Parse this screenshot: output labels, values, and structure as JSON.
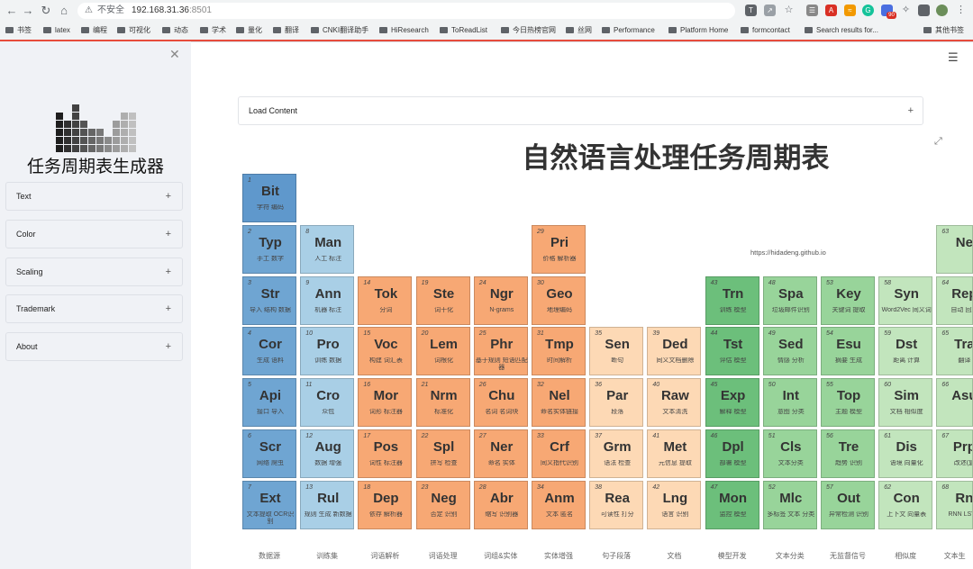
{
  "browser": {
    "nav_icons": [
      "back-icon",
      "forward-icon",
      "reload-icon",
      "home-icon"
    ],
    "insecure_label": "不安全",
    "url_host": "192.168.31.36",
    "url_port": ":8501",
    "bookmarks": [
      "书签",
      "latex",
      "编程",
      "可视化",
      "动态",
      "学术",
      "量化",
      "翻译",
      "CNKI翻译助手",
      "HiResearch",
      "ToReadList",
      "今日热榜官网",
      "丝网",
      "Performance",
      "Platform Home",
      "formcontact",
      "Search results for...",
      "其他书签"
    ],
    "badge_count": "90"
  },
  "sidebar": {
    "app_title": "任务周期表生成器",
    "sections": [
      "Text",
      "Color",
      "Scaling",
      "Trademark",
      "About"
    ]
  },
  "main": {
    "load_label": "Load Content",
    "page_title": "自然语言处理任务周期表",
    "credit": "https://hidadeng.github.io"
  },
  "palette": {
    "blue": "#6fa5d2",
    "blue_light": "#a9cfe6",
    "orange": "#f7a874",
    "peach": "#fdd9b5",
    "green_dark": "#6cbf7b",
    "green": "#98d49a",
    "green_light": "#c2e5bd"
  },
  "elements": [
    {
      "num": "1",
      "sym": "Bit",
      "cn": "字符 编码",
      "col": 0,
      "row": 0,
      "color": "blue_dark"
    },
    {
      "num": "2",
      "sym": "Typ",
      "cn": "手工 数字",
      "col": 0,
      "row": 1,
      "color": "blue"
    },
    {
      "num": "3",
      "sym": "Str",
      "cn": "导入 结构 数据",
      "col": 0,
      "row": 2,
      "color": "blue"
    },
    {
      "num": "4",
      "sym": "Cor",
      "cn": "生成 语料",
      "col": 0,
      "row": 3,
      "color": "blue"
    },
    {
      "num": "5",
      "sym": "Api",
      "cn": "接口 导入",
      "col": 0,
      "row": 4,
      "color": "blue"
    },
    {
      "num": "6",
      "sym": "Scr",
      "cn": "网络 爬虫",
      "col": 0,
      "row": 5,
      "color": "blue"
    },
    {
      "num": "7",
      "sym": "Ext",
      "cn": "文本提取 OCR识别",
      "col": 0,
      "row": 6,
      "color": "blue"
    },
    {
      "num": "8",
      "sym": "Man",
      "cn": "人工 标注",
      "col": 1,
      "row": 1,
      "color": "blue_light"
    },
    {
      "num": "9",
      "sym": "Ann",
      "cn": "机器 标注",
      "col": 1,
      "row": 2,
      "color": "blue_light"
    },
    {
      "num": "10",
      "sym": "Pro",
      "cn": "训练 数据",
      "col": 1,
      "row": 3,
      "color": "blue_light"
    },
    {
      "num": "11",
      "sym": "Cro",
      "cn": "众包",
      "col": 1,
      "row": 4,
      "color": "blue_light"
    },
    {
      "num": "12",
      "sym": "Aug",
      "cn": "数据 增强",
      "col": 1,
      "row": 5,
      "color": "blue_light"
    },
    {
      "num": "13",
      "sym": "Rul",
      "cn": "规则 生成 新数据",
      "col": 1,
      "row": 6,
      "color": "blue_light"
    },
    {
      "num": "14",
      "sym": "Tok",
      "cn": "分词",
      "col": 2,
      "row": 2,
      "color": "orange"
    },
    {
      "num": "15",
      "sym": "Voc",
      "cn": "构建 词汇表",
      "col": 2,
      "row": 3,
      "color": "orange"
    },
    {
      "num": "16",
      "sym": "Mor",
      "cn": "词形 标注器",
      "col": 2,
      "row": 4,
      "color": "orange"
    },
    {
      "num": "17",
      "sym": "Pos",
      "cn": "词性 标注器",
      "col": 2,
      "row": 5,
      "color": "orange"
    },
    {
      "num": "18",
      "sym": "Dep",
      "cn": "依存 解析器",
      "col": 2,
      "row": 6,
      "color": "orange"
    },
    {
      "num": "19",
      "sym": "Ste",
      "cn": "词干化",
      "col": 3,
      "row": 2,
      "color": "orange"
    },
    {
      "num": "20",
      "sym": "Lem",
      "cn": "词根化",
      "col": 3,
      "row": 3,
      "color": "orange"
    },
    {
      "num": "21",
      "sym": "Nrm",
      "cn": "标准化",
      "col": 3,
      "row": 4,
      "color": "orange"
    },
    {
      "num": "22",
      "sym": "Spl",
      "cn": "拼写 检查",
      "col": 3,
      "row": 5,
      "color": "orange"
    },
    {
      "num": "23",
      "sym": "Neg",
      "cn": "否定 识别",
      "col": 3,
      "row": 6,
      "color": "orange"
    },
    {
      "num": "24",
      "sym": "Ngr",
      "cn": "N-grams",
      "col": 4,
      "row": 2,
      "color": "orange"
    },
    {
      "num": "25",
      "sym": "Phr",
      "cn": "基于规则 短语匹配器",
      "col": 4,
      "row": 3,
      "color": "orange"
    },
    {
      "num": "26",
      "sym": "Chu",
      "cn": "名词 名词块",
      "col": 4,
      "row": 4,
      "color": "orange"
    },
    {
      "num": "27",
      "sym": "Ner",
      "cn": "命名 实体",
      "col": 4,
      "row": 5,
      "color": "orange"
    },
    {
      "num": "28",
      "sym": "Abr",
      "cn": "缩写 识别器",
      "col": 4,
      "row": 6,
      "color": "orange"
    },
    {
      "num": "29",
      "sym": "Pri",
      "cn": "价格 解析器",
      "col": 5,
      "row": 1,
      "color": "orange"
    },
    {
      "num": "30",
      "sym": "Geo",
      "cn": "地理编码",
      "col": 5,
      "row": 2,
      "color": "orange"
    },
    {
      "num": "31",
      "sym": "Tmp",
      "cn": "时间解析",
      "col": 5,
      "row": 3,
      "color": "orange"
    },
    {
      "num": "32",
      "sym": "Nel",
      "cn": "命名实体链接",
      "col": 5,
      "row": 4,
      "color": "orange"
    },
    {
      "num": "33",
      "sym": "Crf",
      "cn": "同义指代识别",
      "col": 5,
      "row": 5,
      "color": "orange"
    },
    {
      "num": "34",
      "sym": "Anm",
      "cn": "文本 匿名",
      "col": 5,
      "row": 6,
      "color": "orange"
    },
    {
      "num": "35",
      "sym": "Sen",
      "cn": "断句",
      "col": 6,
      "row": 3,
      "color": "peach"
    },
    {
      "num": "36",
      "sym": "Par",
      "cn": "段落",
      "col": 6,
      "row": 4,
      "color": "peach"
    },
    {
      "num": "37",
      "sym": "Grm",
      "cn": "语法 检查",
      "col": 6,
      "row": 5,
      "color": "peach"
    },
    {
      "num": "38",
      "sym": "Rea",
      "cn": "可读性 打分",
      "col": 6,
      "row": 6,
      "color": "peach"
    },
    {
      "num": "39",
      "sym": "Ded",
      "cn": "同义文档删除",
      "col": 7,
      "row": 3,
      "color": "peach"
    },
    {
      "num": "40",
      "sym": "Raw",
      "cn": "文本清洗",
      "col": 7,
      "row": 4,
      "color": "peach"
    },
    {
      "num": "41",
      "sym": "Met",
      "cn": "元信息 提取",
      "col": 7,
      "row": 5,
      "color": "peach"
    },
    {
      "num": "42",
      "sym": "Lng",
      "cn": "语言 识别",
      "col": 7,
      "row": 6,
      "color": "peach"
    },
    {
      "num": "43",
      "sym": "Trn",
      "cn": "训练 模型",
      "col": 8,
      "row": 2,
      "color": "green_dark"
    },
    {
      "num": "44",
      "sym": "Tst",
      "cn": "评估 模型",
      "col": 8,
      "row": 3,
      "color": "green_dark"
    },
    {
      "num": "45",
      "sym": "Exp",
      "cn": "解释 模型",
      "col": 8,
      "row": 4,
      "color": "green_dark"
    },
    {
      "num": "46",
      "sym": "Dpl",
      "cn": "部署 模型",
      "col": 8,
      "row": 5,
      "color": "green_dark"
    },
    {
      "num": "47",
      "sym": "Mon",
      "cn": "监控 模型",
      "col": 8,
      "row": 6,
      "color": "green_dark"
    },
    {
      "num": "48",
      "sym": "Spa",
      "cn": "垃圾邮件识别",
      "col": 9,
      "row": 2,
      "color": "green"
    },
    {
      "num": "49",
      "sym": "Sed",
      "cn": "情感 分析",
      "col": 9,
      "row": 3,
      "color": "green"
    },
    {
      "num": "50",
      "sym": "Int",
      "cn": "意图 分类",
      "col": 9,
      "row": 4,
      "color": "green"
    },
    {
      "num": "51",
      "sym": "Cls",
      "cn": "文本分类",
      "col": 9,
      "row": 5,
      "color": "green"
    },
    {
      "num": "52",
      "sym": "Mlc",
      "cn": "多标签 文本 分类",
      "col": 9,
      "row": 6,
      "color": "green"
    },
    {
      "num": "53",
      "sym": "Key",
      "cn": "关键词 提取",
      "col": 10,
      "row": 2,
      "color": "green"
    },
    {
      "num": "54",
      "sym": "Esu",
      "cn": "摘要 生成",
      "col": 10,
      "row": 3,
      "color": "green"
    },
    {
      "num": "55",
      "sym": "Top",
      "cn": "主题 模型",
      "col": 10,
      "row": 4,
      "color": "green"
    },
    {
      "num": "56",
      "sym": "Tre",
      "cn": "趋势 识别",
      "col": 10,
      "row": 5,
      "color": "green"
    },
    {
      "num": "57",
      "sym": "Out",
      "cn": "异常检测 识别",
      "col": 10,
      "row": 6,
      "color": "green"
    },
    {
      "num": "58",
      "sym": "Syn",
      "cn": "Word2Vec 同义词",
      "col": 11,
      "row": 2,
      "color": "green_light"
    },
    {
      "num": "59",
      "sym": "Dst",
      "cn": "距离 计算",
      "col": 11,
      "row": 3,
      "color": "green_light"
    },
    {
      "num": "60",
      "sym": "Sim",
      "cn": "文档 相似度",
      "col": 11,
      "row": 4,
      "color": "green_light"
    },
    {
      "num": "61",
      "sym": "Dis",
      "cn": "语境 向量化",
      "col": 11,
      "row": 5,
      "color": "green_light"
    },
    {
      "num": "62",
      "sym": "Con",
      "cn": "上下文 向量表",
      "col": 11,
      "row": 6,
      "color": "green_light"
    },
    {
      "num": "63",
      "sym": "Ne",
      "cn": "",
      "col": 12,
      "row": 1,
      "color": "green_light"
    },
    {
      "num": "64",
      "sym": "Rep",
      "cn": "自动 回复",
      "col": 12,
      "row": 2,
      "color": "green_light"
    },
    {
      "num": "65",
      "sym": "Tra",
      "cn": "翻译",
      "col": 12,
      "row": 3,
      "color": "green_light"
    },
    {
      "num": "66",
      "sym": "Asu",
      "cn": "",
      "col": 12,
      "row": 4,
      "color": "green_light"
    },
    {
      "num": "67",
      "sym": "Prp",
      "cn": "改述(复",
      "col": 12,
      "row": 5,
      "color": "green_light"
    },
    {
      "num": "68",
      "sym": "Rn",
      "cn": "RNN LSTM",
      "col": 12,
      "row": 6,
      "color": "green_light"
    }
  ],
  "groups": [
    "数据源",
    "训练集",
    "词语解析",
    "词语处理",
    "词组&实体",
    "实体增强",
    "句子段落",
    "文档",
    "模型开发",
    "文本分类",
    "无监督信号",
    "相似度",
    "文本生"
  ]
}
